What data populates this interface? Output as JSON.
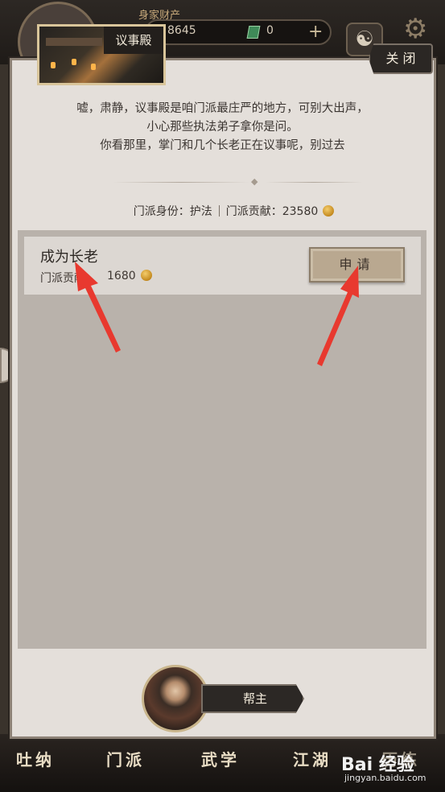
{
  "topbar": {
    "assets_label": "身家财产",
    "coins": "8645",
    "gems": "0",
    "plus_icon": "plus-icon",
    "taiji_icon": "taiji-icon",
    "settings_icon": "gear-icon"
  },
  "dialog": {
    "title": "议事殿",
    "close_label": "关 闭",
    "dialogue": [
      "嘘，肃静，议事殿是咱门派最庄严的地方，可别大出声，",
      "小心那些执法弟子拿你是问。",
      "你看那里，掌门和几个长老正在议事呢，别过去"
    ],
    "stats": {
      "identity_label": "门派身份：",
      "identity_value": "护法",
      "contribution_label": "门派贡献：",
      "contribution_value": "23580"
    },
    "rows": [
      {
        "title": "成为长老",
        "cost_label": "门派贡献：",
        "cost_value": "1680",
        "button_label": "申请"
      }
    ],
    "leader": {
      "label": "帮主"
    }
  },
  "bottom_nav": [
    "吐纳",
    "门派",
    "武学",
    "江湖",
    "历练"
  ],
  "watermark": {
    "main": "Bai 经验",
    "sub": "jingyan.baidu.com"
  },
  "colors": {
    "dialog_bg": "#e4dfda",
    "panel_bg": "#b9b2ab",
    "arrow": "#e8392f",
    "coin": "#d19a2a"
  }
}
